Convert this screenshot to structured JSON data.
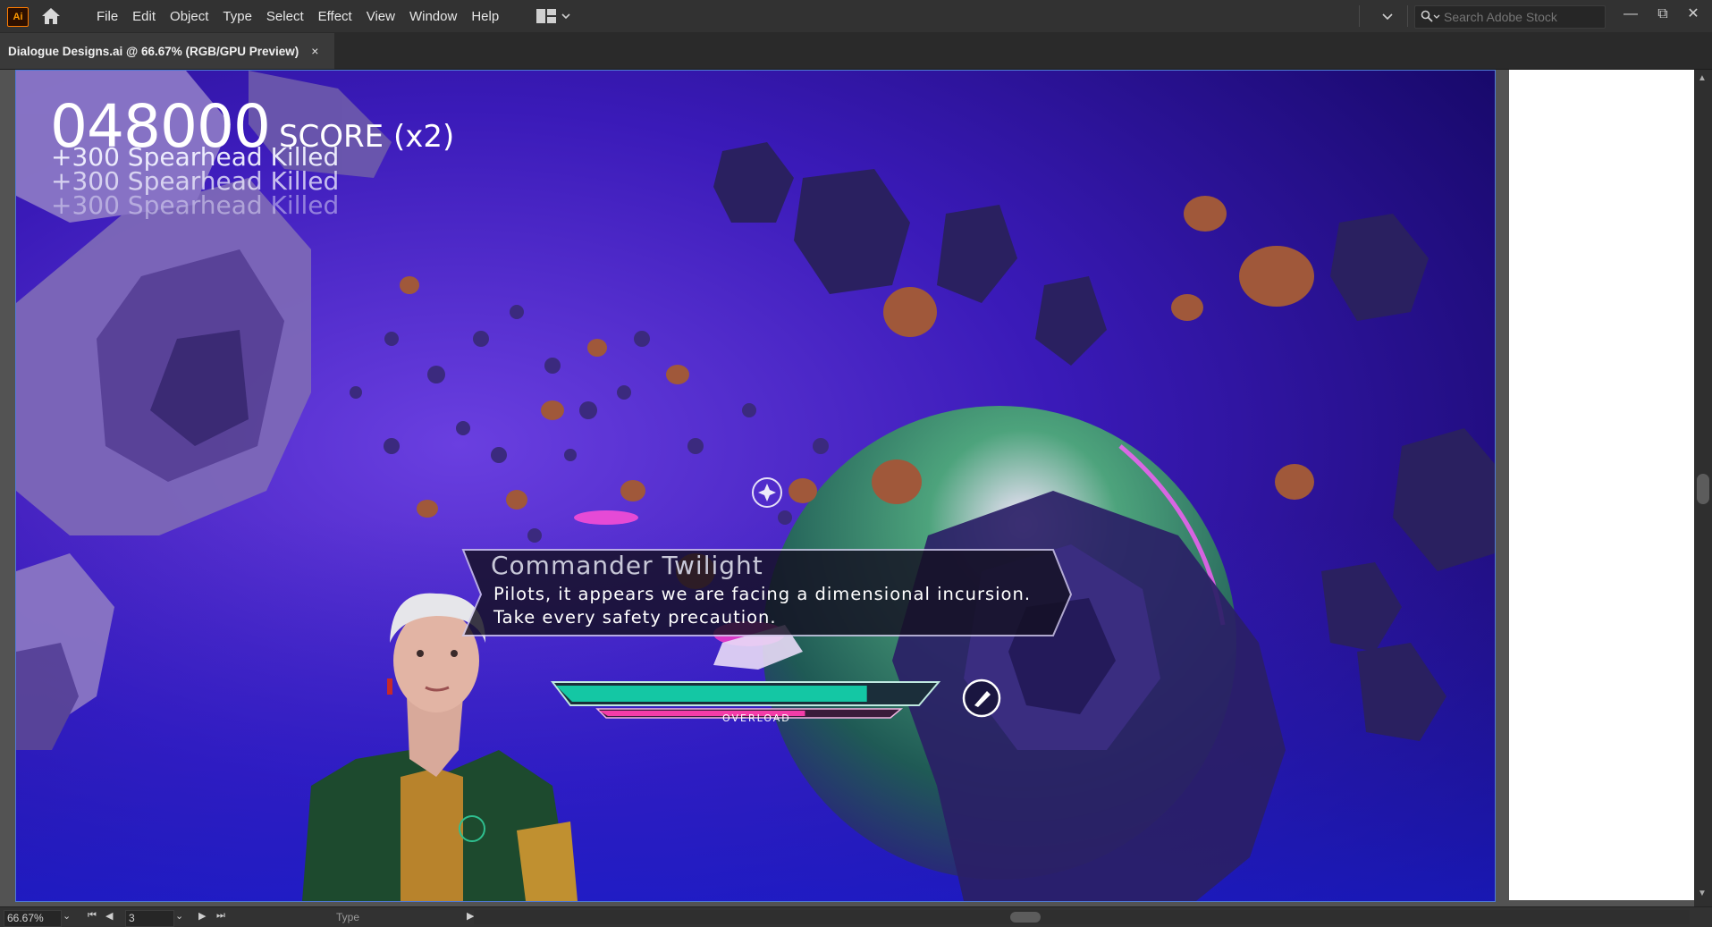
{
  "app": {
    "logo": "Ai",
    "home_icon": "home-icon"
  },
  "menu": {
    "items": [
      "File",
      "Edit",
      "Object",
      "Type",
      "Select",
      "Effect",
      "View",
      "Window",
      "Help"
    ]
  },
  "search": {
    "placeholder": "Search Adobe Stock"
  },
  "tab": {
    "title": "Dialogue Designs.ai @ 66.67% (RGB/GPU Preview)",
    "close": "×"
  },
  "hud": {
    "score": "048000",
    "score_label": "SCORE (x2)",
    "kills": [
      "+300 Spearhead Killed",
      "+300 Spearhead Killed",
      "+300 Spearhead Killed"
    ],
    "speaker": "Commander Twilight",
    "dialogue": [
      "Pilots, it appears we are facing a dimensional incursion.",
      "Take every safety precaution."
    ],
    "overload_label": "OVERLOAD",
    "health_fraction": 0.82,
    "overload_fraction": 0.69,
    "colors": {
      "health": "#14c7a4",
      "overload": "#f43ca8",
      "space": "#2a0fa5"
    }
  },
  "status": {
    "zoom": "66.67%",
    "page": "3",
    "tool": "Type"
  }
}
